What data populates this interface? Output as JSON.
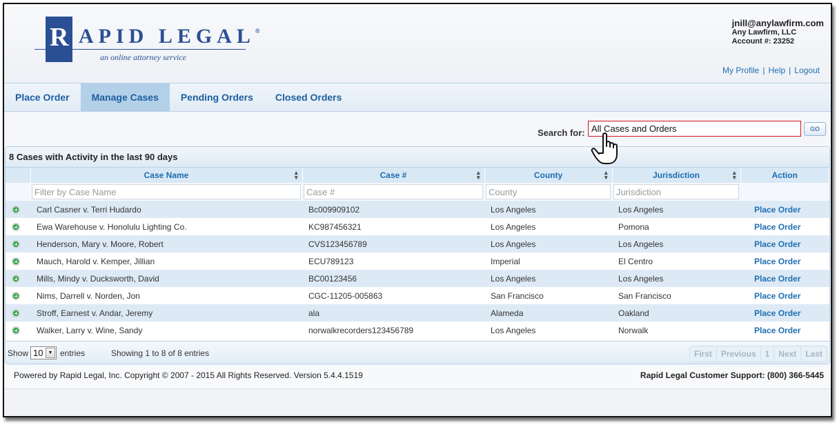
{
  "brand": {
    "logo_initial": "R",
    "logo_rest": "APID LEGAL",
    "logo_reg": "®",
    "tagline": "an online attorney service"
  },
  "account": {
    "email": "jnill@anylawfirm.com",
    "firm": "Any Lawfirm, LLC",
    "account_number": "Account #: 23252",
    "links": [
      "My Profile",
      "Help",
      "Logout"
    ],
    "separator": "|"
  },
  "nav": {
    "tabs": [
      {
        "label": "Place Order",
        "active": false
      },
      {
        "label": "Manage Cases",
        "active": true
      },
      {
        "label": "Pending Orders",
        "active": false
      },
      {
        "label": "Closed Orders",
        "active": false
      }
    ]
  },
  "search": {
    "label": "Search for:",
    "value": "All Cases and Orders",
    "go_label": "GO",
    "highlight_color": "#d0141b"
  },
  "grid": {
    "title": "8 Cases with Activity in the last 90 days",
    "columns": [
      {
        "label": "",
        "sortable": false
      },
      {
        "label": "Case Name",
        "sortable": true
      },
      {
        "label": "Case #",
        "sortable": true
      },
      {
        "label": "County",
        "sortable": true
      },
      {
        "label": "Jurisdiction",
        "sortable": true
      },
      {
        "label": "Action",
        "sortable": false
      }
    ],
    "sort_icon": "⇕",
    "filters": {
      "case_name": "Filter by Case Name",
      "case_number": "Case #",
      "county": "County",
      "jurisdiction": "Jurisdiction"
    },
    "rows": [
      {
        "case_name": "Carl Casner v. Terri Hudardo",
        "case_number": "Bc009909102",
        "county": "Los Angeles",
        "jurisdiction": "Los Angeles",
        "action": "Place Order"
      },
      {
        "case_name": "Ewa Warehouse v. Honolulu Lighting Co.",
        "case_number": "KC987456321",
        "county": "Los Angeles",
        "jurisdiction": "Pomona",
        "action": "Place Order"
      },
      {
        "case_name": "Henderson, Mary v. Moore, Robert",
        "case_number": "CVS123456789",
        "county": "Los Angeles",
        "jurisdiction": "Los Angeles",
        "action": "Place Order"
      },
      {
        "case_name": "Mauch, Harold v. Kemper, Jillian",
        "case_number": "ECU789123",
        "county": "Imperial",
        "jurisdiction": "El Centro",
        "action": "Place Order"
      },
      {
        "case_name": "Mills, Mindy v. Ducksworth, David",
        "case_number": "BC00123456",
        "county": "Los Angeles",
        "jurisdiction": "Los Angeles",
        "action": "Place Order"
      },
      {
        "case_name": "Nims, Darrell v. Norden, Jon",
        "case_number": "CGC-11205-005863",
        "county": "San Francisco",
        "jurisdiction": "San Francisco",
        "action": "Place Order"
      },
      {
        "case_name": "Stroff, Earnest v. Andar, Jeremy",
        "case_number": "ala",
        "county": "Alameda",
        "jurisdiction": "Oakland",
        "action": "Place Order"
      },
      {
        "case_name": "Walker, Larry v. Wine, Sandy",
        "case_number": "norwalkrecorders123456789",
        "county": "Los Angeles",
        "jurisdiction": "Norwalk",
        "action": "Place Order"
      }
    ],
    "footer": {
      "show_label": "Show",
      "page_size": "10",
      "entries_label": "entries",
      "info": "Showing 1 to 8 of 8 entries",
      "pager": [
        "First",
        "Previous",
        "1",
        "Next",
        "Last"
      ]
    }
  },
  "footer": {
    "copyright": "Powered by Rapid Legal, Inc. Copyright © 2007 - 2015 All Rights Reserved.  Version 5.4.4.1519",
    "support": "Rapid Legal Customer Support: (800) 366-5445"
  }
}
